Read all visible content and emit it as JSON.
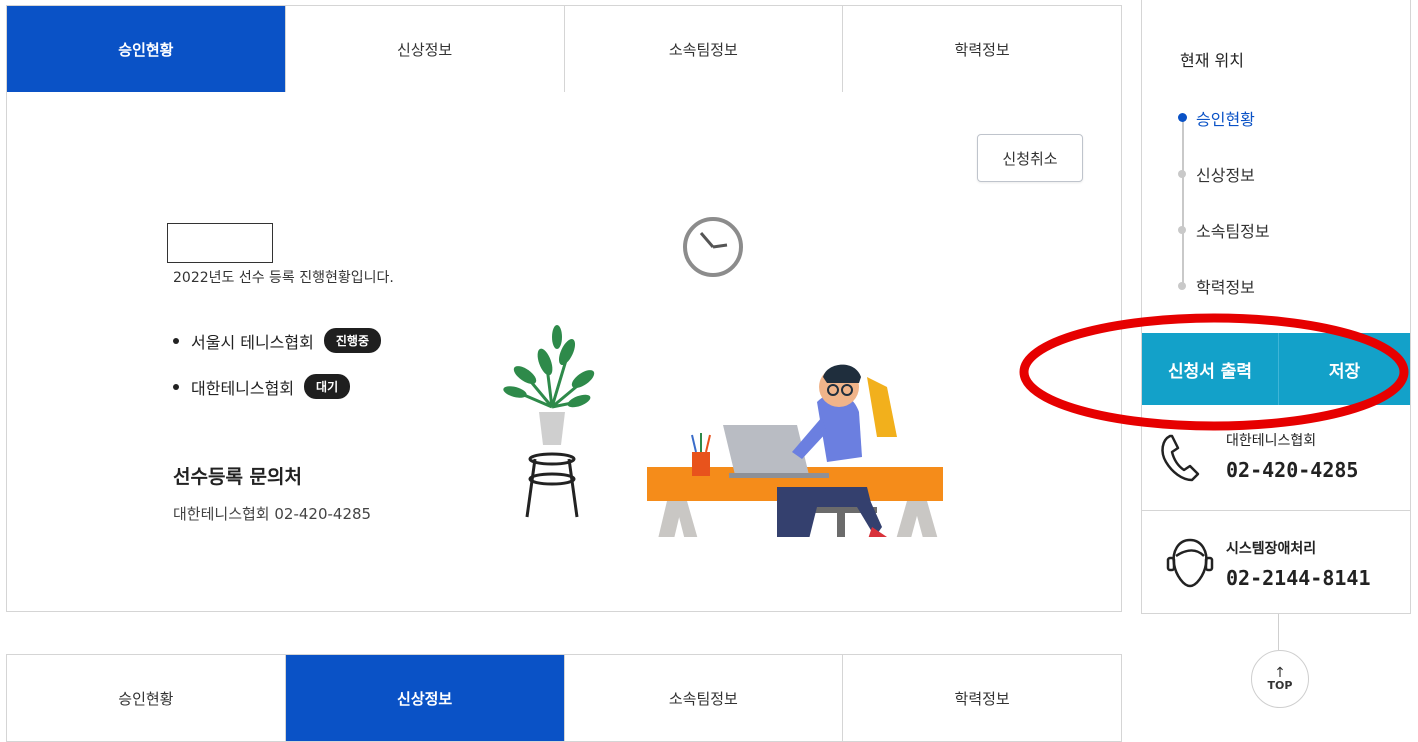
{
  "tabs_top": [
    {
      "label": "승인현황",
      "active": true
    },
    {
      "label": "신상정보",
      "active": false
    },
    {
      "label": "소속팀정보",
      "active": false
    },
    {
      "label": "학력정보",
      "active": false
    }
  ],
  "tabs_bottom": [
    {
      "label": "승인현황",
      "active": false
    },
    {
      "label": "신상정보",
      "active": true
    },
    {
      "label": "소속팀정보",
      "active": false
    },
    {
      "label": "학력정보",
      "active": false
    }
  ],
  "panel": {
    "cancel_label": "신청취소",
    "intro": "2022년도 선수 등록 진행현황입니다.",
    "associations": [
      {
        "name": "서울시 테니스협회",
        "status": "진행중"
      },
      {
        "name": "대한테니스협회",
        "status": "대기"
      }
    ],
    "contact_title": "선수등록 문의처",
    "contact_value": "대한테니스협회 02-420-4285"
  },
  "sidebar": {
    "heading": "현재 위치",
    "nav": [
      {
        "label": "승인현황",
        "current": true
      },
      {
        "label": "신상정보",
        "current": false
      },
      {
        "label": "소속팀정보",
        "current": false
      },
      {
        "label": "학력정보",
        "current": false
      }
    ],
    "actions": {
      "print": "신청서 출력",
      "save": "저장"
    },
    "help": [
      {
        "label": "대한테니스협회",
        "phone": "02-420-4285",
        "icon": "phone-icon"
      },
      {
        "label": "시스템장애처리",
        "phone": "02-2144-8141",
        "icon": "headset-icon"
      }
    ],
    "top_label": "TOP"
  },
  "colors": {
    "accent": "#0a52c6",
    "action_bar": "#13a1c9",
    "highlight": "#e60000"
  }
}
